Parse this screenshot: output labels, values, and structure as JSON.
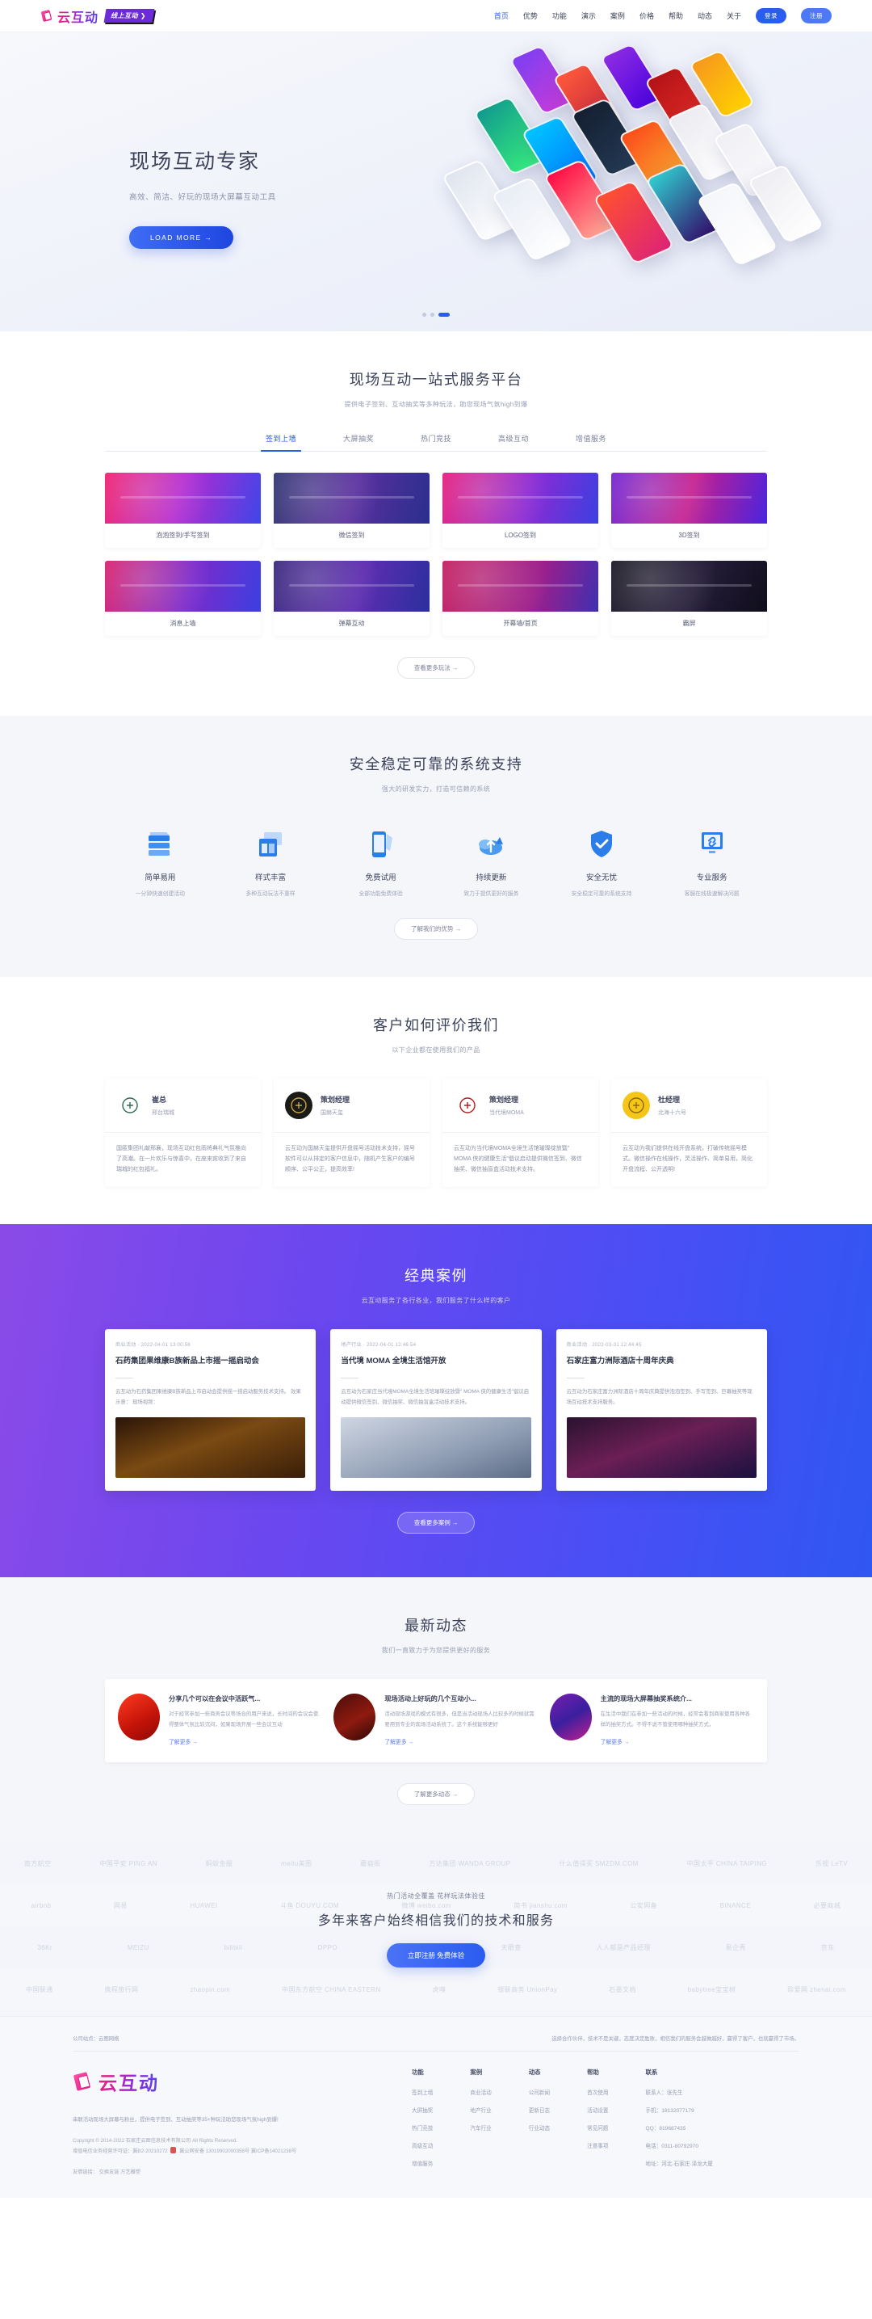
{
  "header": {
    "brand": "云互动",
    "online_tag": "线上互动 ❯",
    "nav": [
      {
        "label": "首页",
        "active": true
      },
      {
        "label": "优势",
        "active": false
      },
      {
        "label": "功能",
        "active": false
      },
      {
        "label": "演示",
        "active": false
      },
      {
        "label": "案例",
        "active": false
      },
      {
        "label": "价格",
        "active": false
      },
      {
        "label": "帮助",
        "active": false
      },
      {
        "label": "动态",
        "active": false
      },
      {
        "label": "关于",
        "active": false
      }
    ],
    "login": "登录",
    "register": "注册"
  },
  "hero": {
    "title": "现场互动专家",
    "subtitle": "高效、简洁、好玩的现场大屏幕互动工具",
    "cta": "LOAD MORE →",
    "slide_count": 3,
    "active_slide": 3
  },
  "services": {
    "title": "现场互动一站式服务平台",
    "subtitle": "提供电子签到、互动抽奖等多种玩法，助您现场气氛high到爆",
    "tabs": [
      {
        "label": "签到上墙",
        "active": true
      },
      {
        "label": "大屏抽奖",
        "active": false
      },
      {
        "label": "热门竞技",
        "active": false
      },
      {
        "label": "高级互动",
        "active": false
      },
      {
        "label": "增值服务",
        "active": false
      }
    ],
    "cards": [
      {
        "label": "泡泡签到/手写签到",
        "theme": "t1"
      },
      {
        "label": "微信签到",
        "theme": "t2"
      },
      {
        "label": "LOGO签到",
        "theme": "t3"
      },
      {
        "label": "3D签到",
        "theme": "t4"
      },
      {
        "label": "消息上墙",
        "theme": "t5"
      },
      {
        "label": "弹幕互动",
        "theme": "t6"
      },
      {
        "label": "开幕墙/首页",
        "theme": "t7"
      },
      {
        "label": "霸屏",
        "theme": "t8"
      }
    ],
    "more": "查看更多玩法 →"
  },
  "features": {
    "title": "安全稳定可靠的系统支持",
    "subtitle": "强大的研发实力，打造可信赖的系统",
    "items": [
      {
        "icon": "server-stack-icon",
        "title": "简单易用",
        "desc": "一分钟快速创建活动"
      },
      {
        "icon": "layout-template-icon",
        "title": "样式丰富",
        "desc": "多种互动玩法不重样"
      },
      {
        "icon": "mobile-yuan-icon",
        "title": "免费试用",
        "desc": "全部功能免费体验"
      },
      {
        "icon": "cloud-upload-icon",
        "title": "持续更新",
        "desc": "致力于提供更好的服务"
      },
      {
        "icon": "shield-check-icon",
        "title": "安全无忧",
        "desc": "安全稳定可靠的系统支持"
      },
      {
        "icon": "monitor-link-icon",
        "title": "专业服务",
        "desc": "客服在线极速解决问题"
      }
    ],
    "more": "了解我们的优势 →"
  },
  "testimonials": {
    "title": "客户如何评价我们",
    "subtitle": "以下企业都在使用我们的产品",
    "items": [
      {
        "logo": "ruicheng-logo",
        "logo_color": "#2f6b4f",
        "logo_bg": "#ffffff",
        "name": "崔总",
        "org": "邢台瑞城",
        "quote": "国匿集团礼献邢襄，现场互动红包雨将典礼气氛推向了高潮。在一片欢乐与惊喜中，在座来宾收到了来自瑞城的红包福礼。"
      },
      {
        "logo": "cullinan-logo",
        "logo_color": "#c8a24a",
        "logo_bg": "#1a1a16",
        "name": "策划经理",
        "org": "国赫天玺",
        "quote": "云互动为国赫天玺提供开盘摇号活动技术支持，摇号软件可以从排定的客户信息中，随机产生客户的编号顺序、公平公正，提高效率!"
      },
      {
        "logo": "moma-logo",
        "logo_color": "#b02020",
        "logo_bg": "#ffffff",
        "name": "策划经理",
        "org": "当代境MOMA",
        "quote": "云互动为当代境MOMA全境生活馆璀璨绽放暨\" MOMA 侠的健康生活\"倡议启动提供微信签到、微信抽奖、微信抽盲盒活动技术支持。"
      },
      {
        "logo": "beihai16-logo",
        "logo_color": "#8a6a10",
        "logo_bg": "#f5c518",
        "name": "杜经理",
        "org": "北海十六号",
        "quote": "云互动为我们提供在线开盘系统，打破传统摇号模式。微信操作在线操作，灵活操作、简单易用，简化开盘流程、公开透明!"
      }
    ]
  },
  "cases": {
    "title": "经典案例",
    "subtitle": "云互动服务了各行各业，我们服务了什么样的客户",
    "items": [
      {
        "meta": "商业活动 · 2022-04-01 13:00:56",
        "title": "石药集团果维康B族新品上市摇一摇启动会",
        "desc": "云互动为石药集团果维康B族新品上市启动会提供摇一摇启动服务技术支持。 效果示意： 现场视频：",
        "image": "ci1"
      },
      {
        "meta": "地产行业 · 2022-04-01 12:46:54",
        "title": "当代境 MOMA 全境生活馆开放",
        "desc": "云互动为石家庄当代境MOMA全境生活馆璀璨绽放暨\" MOMA 侠的健康生活\"倡议启动提供微信签到、微信抽奖、微信抽盲盒活动技术支持。",
        "image": "ci2"
      },
      {
        "meta": "商业活动 · 2022-03-31 12:44:45",
        "title": "石家庄富力洲际酒店十周年庆典",
        "desc": "云互动为石家庄富力洲际酒店十周年庆典提供泡泡签到、手写签到、巨幕抽奖等现场互动技术支持服务。",
        "image": "ci3"
      }
    ],
    "more": "查看更多案例 →"
  },
  "news": {
    "title": "最新动态",
    "subtitle": "我们一直致力于为您提供更好的服务",
    "items": [
      {
        "thumb": "nt1",
        "title": "分享几个可以在会议中活跃气...",
        "desc": "对于经常参加一些商务会议等场合的用户来说，长时间的会议会使得整体气氛比较沉闷，如果现场开展一些会议互动",
        "more": "了解更多 →"
      },
      {
        "thumb": "nt2",
        "title": "现场活动上好玩的几个互动小...",
        "desc": "活动现场游戏的模式有很多，但是当活动现场人比较多的时候就需要用到专业的现场活动系统了。这个系统能够更好",
        "more": "了解更多 →"
      },
      {
        "thumb": "nt3",
        "title": "主流的现场大屏幕抽奖系统介...",
        "desc": "在生活中我们在参加一些活动的时候，经常会看到商家使用各种各样的抽奖方式。不得不说不管使用哪种抽奖方式，",
        "more": "了解更多 →"
      }
    ],
    "more": "了解更多动态 →"
  },
  "logowall": {
    "rows": [
      [
        "南方航空",
        "中国平安 PING AN",
        "蚂蚁金服",
        "meitu美图",
        "蘑菇街",
        "万达集团 WANDA GROUP",
        "什么值得买 SMZDM.COM",
        "中国太平 CHINA TAIPING",
        "乐视 LeTV"
      ],
      [
        "airbnb",
        "网易",
        "HUAWEI",
        "斗鱼 DOUYU.COM",
        "微博 weibo.com",
        "简书 jianshu.com",
        "公安网备",
        "BINANCE",
        "必要商城"
      ],
      [
        "36Kr",
        "MEIZU",
        "bilibili",
        "OPPO",
        "知乎",
        "天眼查",
        "人人都是产品经理",
        "易企秀",
        "京东"
      ],
      [
        "中国联通",
        "携程旅行网",
        "zhaopin.com",
        "中国东方航空 CHINA EASTERN",
        "虎嗅",
        "银联商务 UnionPay",
        "石墨文档",
        "babytree宝宝树",
        "珍爱网 zhenai.com"
      ]
    ],
    "cta_small": "热门活动全覆盖 花样玩法体验佳",
    "cta_big": "多年来客户始终相信我们的技术和服务",
    "cta_button": "立即注册 免费体验"
  },
  "footer": {
    "sites_label": "公司站点：",
    "sites_value": "云图网络",
    "tagline": "选择合作伙伴，技术不是关键，态度决定胜败，相信我们的服务会越做越好，赢得了客户，也就赢得了市场。",
    "brand": "云互动",
    "slogan": "串联活动现场大屏幕与粉丝，提供电子签到、互动抽奖等35+种玩法助您现场气氛high到爆!",
    "copyright": "Copyright © 2014-2022 石家庄云图信息技术有限公司 All Rights Reserved.",
    "license": "增值电信业务经营许可证：冀B2-20210272",
    "police": "冀公网安备 13019902000358号",
    "icp": "冀ICP备14021238号",
    "friend_label": "友情链接：",
    "friend_links": "交换友链 万艺雕塑",
    "columns": [
      {
        "title": "功能",
        "links": [
          "签到上墙",
          "大屏抽奖",
          "热门竞技",
          "高级互动",
          "增值服务"
        ]
      },
      {
        "title": "案例",
        "links": [
          "商业活动",
          "地产行业",
          "汽车行业"
        ]
      },
      {
        "title": "动态",
        "links": [
          "公司新闻",
          "更新日志",
          "行业动态"
        ]
      },
      {
        "title": "帮助",
        "links": [
          "首次使用",
          "活动设置",
          "常见问题",
          "注意事项"
        ]
      },
      {
        "title": "联系",
        "links": [
          "联系人：张先生",
          "手机：18132077179",
          "QQ：819687435",
          "电话：0311-80792970",
          "地址：河北·石家庄·泽龙大厦"
        ]
      }
    ]
  }
}
